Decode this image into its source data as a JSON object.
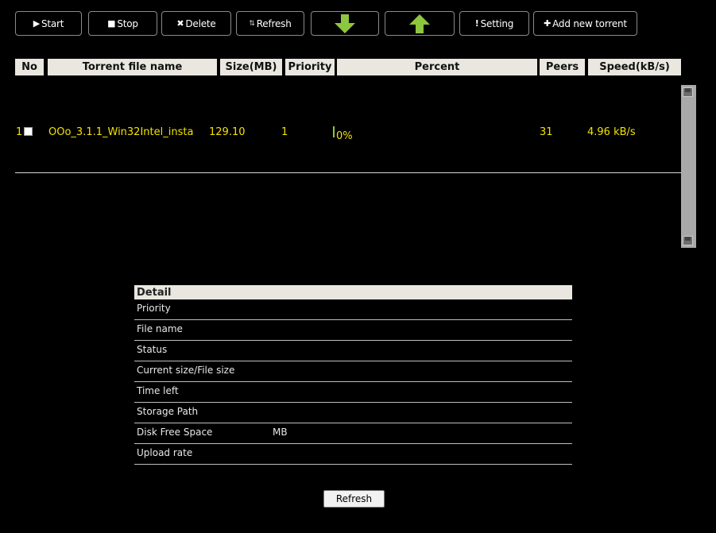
{
  "toolbar": {
    "start": "Start",
    "stop": "Stop",
    "delete": "Delete",
    "refresh": "Refresh",
    "setting": "Setting",
    "add": "Add new torrent",
    "arrow_color": "#8dc63f"
  },
  "table": {
    "headers": [
      "No",
      "Torrent file name",
      "Size(MB)",
      "Priority",
      "Percent",
      "Peers",
      "Speed(kB/s)"
    ],
    "rows": [
      {
        "no": "1",
        "name": "OOo_3.1.1_Win32Intel_insta",
        "size": "129.10",
        "priority": "1",
        "percent": "0%",
        "peers": "31",
        "speed": "4.96 kB/s"
      }
    ]
  },
  "detail": {
    "title": "Detail",
    "rows": [
      {
        "label": "Priority",
        "value": ""
      },
      {
        "label": "File name",
        "value": ""
      },
      {
        "label": "Status",
        "value": ""
      },
      {
        "label": "Current size/File size",
        "value": ""
      },
      {
        "label": "Time left",
        "value": ""
      },
      {
        "label": "Storage Path",
        "value": ""
      },
      {
        "label": "Disk Free Space",
        "value": "MB"
      },
      {
        "label": "Upload rate",
        "value": ""
      }
    ],
    "refresh_label": "Refresh"
  }
}
